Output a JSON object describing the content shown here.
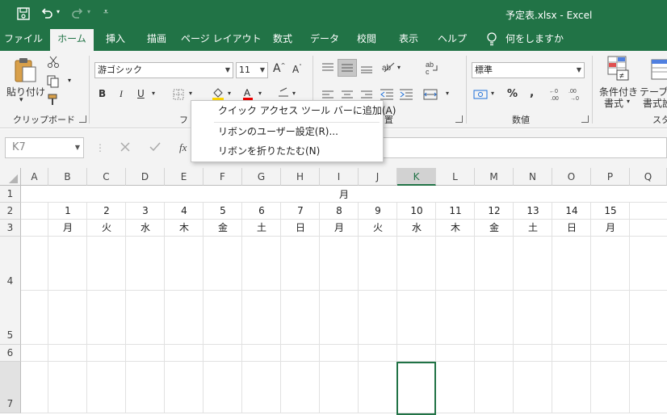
{
  "window": {
    "title": "予定表.xlsx  -  Excel"
  },
  "tabs": [
    "ファイル",
    "ホーム",
    "挿入",
    "描画",
    "ページ レイアウト",
    "数式",
    "データ",
    "校閲",
    "表示",
    "ヘルプ"
  ],
  "active_tab": "ホーム",
  "tell_me": "何をしますか",
  "clipboard": {
    "paste": "貼り付け",
    "group_label": "クリップボード"
  },
  "font": {
    "name": "游ゴシック",
    "size": "11",
    "bold": "B",
    "italic": "I",
    "underline": "U",
    "group_label_partial": "フ"
  },
  "alignment": {
    "group_label_partial": "置"
  },
  "number": {
    "format": "標準",
    "percent": "%",
    "comma": ",",
    "group_label": "数値"
  },
  "styles": {
    "conditional_line1": "条件付き",
    "conditional_line2": "書式",
    "table_line1": "テーブル",
    "table_line2": "書式設",
    "group_label_partial": "スタ"
  },
  "formula_bar": {
    "name_box": "K7",
    "fx": "fx"
  },
  "context_menu": {
    "items": [
      "クイック アクセス ツール バーに追加(A)",
      "リボンのユーザー設定(R)...",
      "リボンを折りたたむ(N)"
    ]
  },
  "columns": [
    "A",
    "B",
    "C",
    "D",
    "E",
    "F",
    "G",
    "H",
    "I",
    "J",
    "K",
    "L",
    "M",
    "N",
    "O",
    "P",
    "Q"
  ],
  "selected_column": "K",
  "rows": [
    "1",
    "2",
    "3",
    "4",
    "5",
    "6",
    "7"
  ],
  "sheet": {
    "row1_title": "月",
    "days": [
      "1",
      "2",
      "3",
      "4",
      "5",
      "6",
      "7",
      "8",
      "9",
      "10",
      "11",
      "12",
      "13",
      "14",
      "15"
    ],
    "weekdays": [
      "月",
      "火",
      "水",
      "木",
      "金",
      "土",
      "日",
      "月",
      "火",
      "水",
      "木",
      "金",
      "土",
      "日",
      "月"
    ]
  },
  "colors": {
    "excel_green": "#217346",
    "ribbon_bg": "#f3f3f3"
  }
}
